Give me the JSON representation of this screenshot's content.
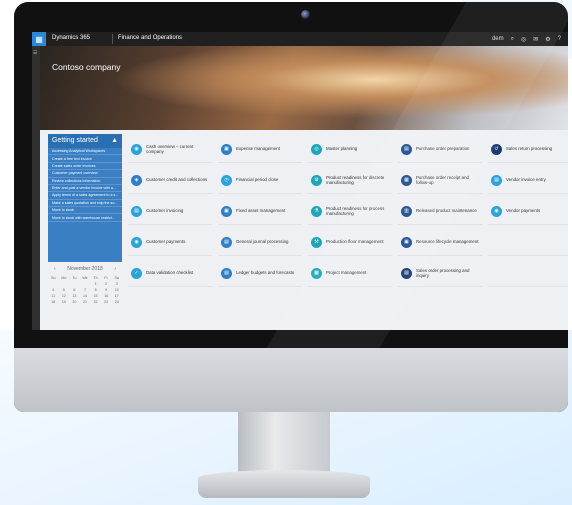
{
  "app": {
    "brand": "Dynamics 365",
    "module": "Finance and Operations",
    "company_title": "Contoso company"
  },
  "nav_icons": [
    "dem",
    "search",
    "settings",
    "feedback",
    "gear",
    "help"
  ],
  "nav_labels": {
    "company_code": "dem",
    "search": "⌕",
    "notifications": "◎",
    "message": "✉",
    "settings": "⚙",
    "help": "?",
    "avatar": "AA"
  },
  "getting_started": {
    "title": "Getting started",
    "items": [
      "Accessing Analytical Workspaces",
      "Create a free text invoice",
      "Create sales order invoices",
      "Customer payment overview",
      "Review collections information",
      "Enter and post a vendor invoice with a...",
      "Apply terms of a sales agreement to a s...",
      "Make a sales quotation and ship the so...",
      "Move to stock",
      "Move to stock with warehouse restrict..."
    ]
  },
  "calendar": {
    "month": "November",
    "year": "2018",
    "weekdays": [
      "Su",
      "Mo",
      "Tu",
      "We",
      "Th",
      "Fr",
      "Sa"
    ],
    "days": [
      "",
      "",
      "",
      "",
      "1",
      "2",
      "3",
      "4",
      "5",
      "6",
      "7",
      "8",
      "9",
      "10",
      "11",
      "12",
      "13",
      "14",
      "15",
      "16",
      "17",
      "18",
      "19",
      "20",
      "21",
      "22",
      "23",
      "24"
    ]
  },
  "tiles": [
    {
      "label": "Cash overview – current company",
      "color": "#2ba3d8",
      "icon": "◉"
    },
    {
      "label": "Expense management",
      "color": "#2e7fc5",
      "icon": "▣"
    },
    {
      "label": "Master planning",
      "color": "#1fa6b8",
      "icon": "◎"
    },
    {
      "label": "Purchase order preparation",
      "color": "#1f4f8f",
      "icon": "▤"
    },
    {
      "label": "Sales return processing",
      "color": "#1a3a70",
      "icon": "↺"
    },
    {
      "label": "Customer credit and collections",
      "color": "#2e7fc5",
      "icon": "◈"
    },
    {
      "label": "Financial period close",
      "color": "#2ba3d8",
      "icon": "◷"
    },
    {
      "label": "Product readiness for discrete manufacturing",
      "color": "#1fa6b8",
      "icon": "⚙"
    },
    {
      "label": "Purchase order receipt and follow-up",
      "color": "#1f4f8f",
      "icon": "▦"
    },
    {
      "label": "Vendor invoice entry",
      "color": "#2ba3d8",
      "icon": "▤"
    },
    {
      "label": "Customer invoicing",
      "color": "#2ba3d8",
      "icon": "▤"
    },
    {
      "label": "Fixed asset management",
      "color": "#2e7fc5",
      "icon": "▣"
    },
    {
      "label": "Product readiness for process manufacturing",
      "color": "#1fa6b8",
      "icon": "⚗"
    },
    {
      "label": "Released product maintenance",
      "color": "#1f4f8f",
      "icon": "▥"
    },
    {
      "label": "Vendor payments",
      "color": "#2ba3d8",
      "icon": "◉"
    },
    {
      "label": "Customer payments",
      "color": "#2ba3d8",
      "icon": "◉"
    },
    {
      "label": "General journal processing",
      "color": "#2e7fc5",
      "icon": "▤"
    },
    {
      "label": "Production floor management",
      "color": "#1fa6b8",
      "icon": "⚒"
    },
    {
      "label": "Resource lifecycle management",
      "color": "#1f4f8f",
      "icon": "▣"
    },
    {
      "label": "",
      "color": "",
      "icon": ""
    },
    {
      "label": "Data validation checklist",
      "color": "#2ba3d8",
      "icon": "✓"
    },
    {
      "label": "Ledger budgets and forecasts",
      "color": "#2e7fc5",
      "icon": "▤"
    },
    {
      "label": "Project management",
      "color": "#1fa6b8",
      "icon": "▦"
    },
    {
      "label": "Sales order processing and inquiry",
      "color": "#1a3a70",
      "icon": "▤"
    },
    {
      "label": "",
      "color": "",
      "icon": ""
    }
  ]
}
